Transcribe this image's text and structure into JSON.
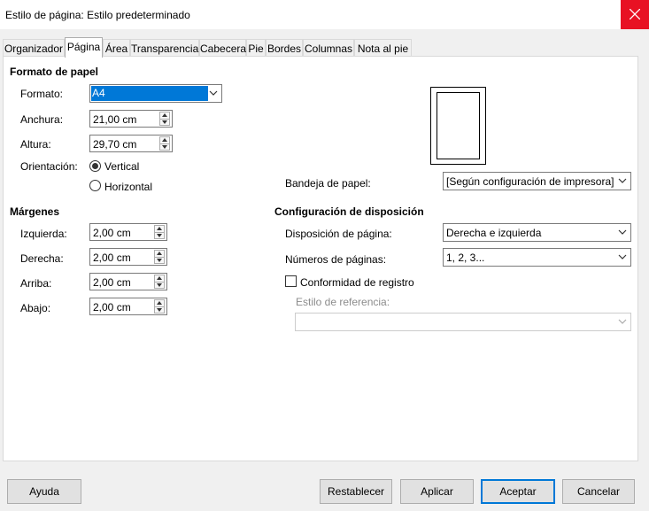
{
  "window": {
    "title": "Estilo de página: Estilo predeterminado"
  },
  "tabs": [
    "Organizador",
    "Página",
    "Área",
    "Transparencia",
    "Cabecera",
    "Pie",
    "Bordes",
    "Columnas",
    "Nota al pie"
  ],
  "paper_format": {
    "heading": "Formato de papel",
    "format_label": "Formato:",
    "format_value": "A4",
    "width_label": "Anchura:",
    "width_value": "21,00 cm",
    "height_label": "Altura:",
    "height_value": "29,70 cm",
    "orientation_label": "Orientación:",
    "portrait_label": "Vertical",
    "landscape_label": "Horizontal",
    "paper_tray_label": "Bandeja de papel:",
    "paper_tray_value": "[Según configuración de impresora]"
  },
  "margins": {
    "heading": "Márgenes",
    "left_label": "Izquierda:",
    "left_value": "2,00 cm",
    "right_label": "Derecha:",
    "right_value": "2,00 cm",
    "top_label": "Arriba:",
    "top_value": "2,00 cm",
    "bottom_label": "Abajo:",
    "bottom_value": "2,00 cm"
  },
  "layout": {
    "heading": "Configuración de disposición",
    "page_layout_label": "Disposición de página:",
    "page_layout_value": "Derecha e izquierda",
    "page_numbers_label": "Números de páginas:",
    "page_numbers_value": "1, 2, 3...",
    "register_true_label": "Conformidad de registro",
    "reference_style_label": "Estilo de referencia:",
    "reference_style_value": ""
  },
  "buttons": {
    "help": "Ayuda",
    "reset": "Restablecer",
    "apply": "Aplicar",
    "ok": "Aceptar",
    "cancel": "Cancelar"
  },
  "colors": {
    "close_button": "#e81123",
    "selection": "#0078d7"
  },
  "icons": {
    "close": "close-icon",
    "dropdown": "chevron-down-icon"
  }
}
